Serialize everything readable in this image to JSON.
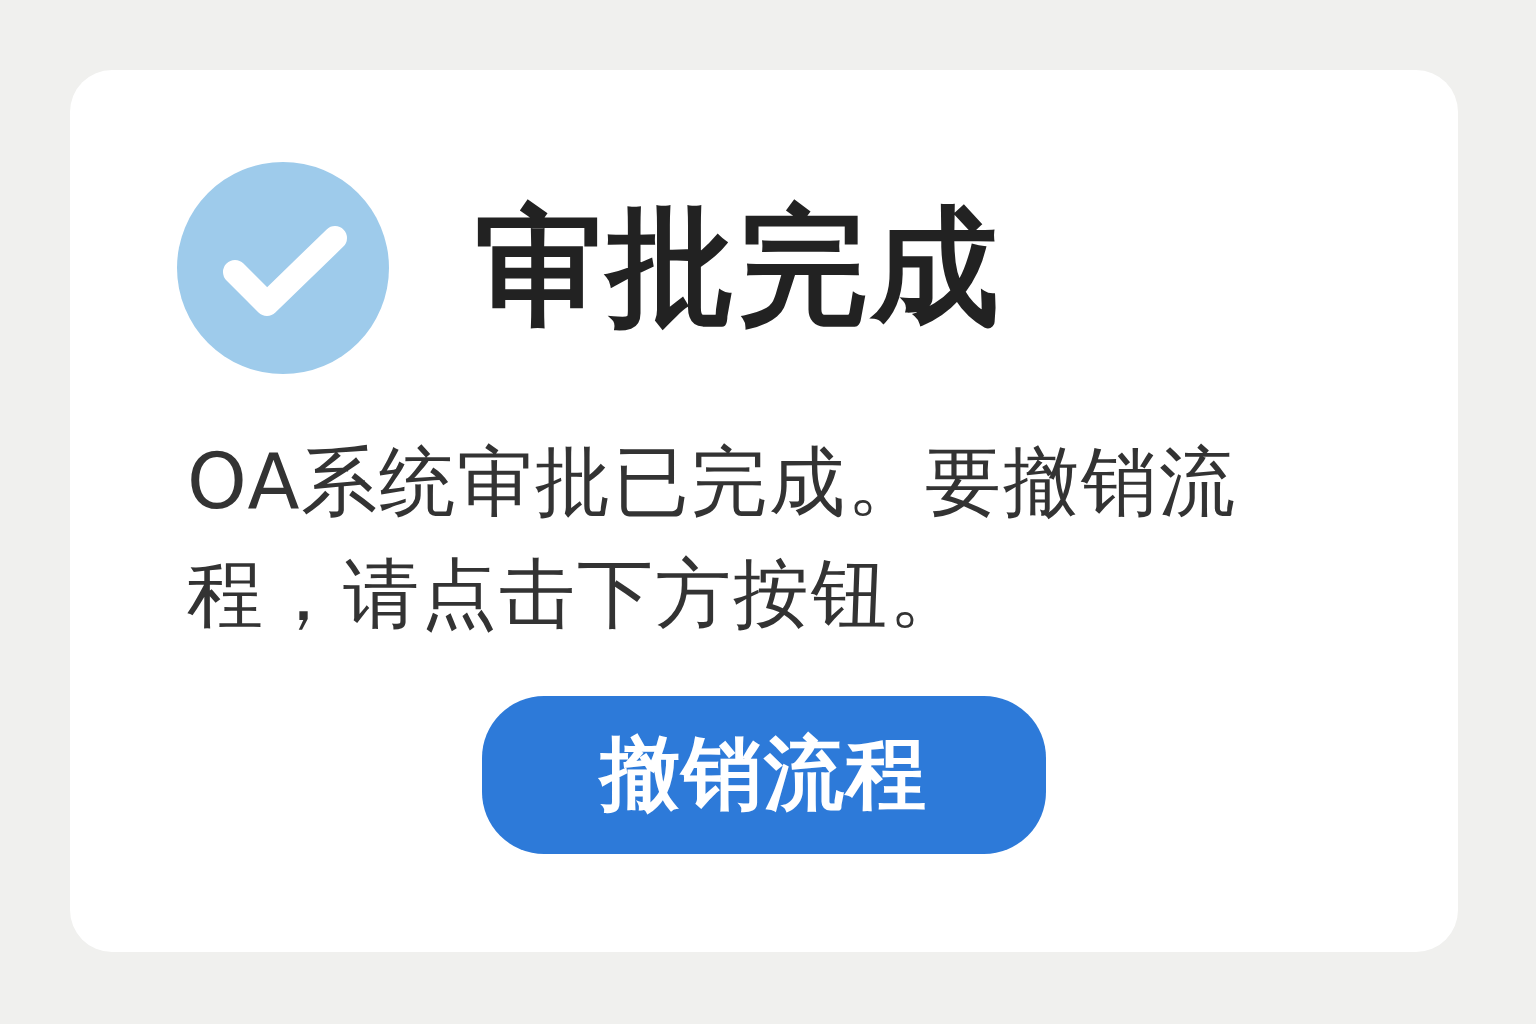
{
  "dialog": {
    "title": "审批完成",
    "success": true,
    "message": "OA系统审批已完成。要撤销流程，请点击下方按钮。",
    "button": "撤销流程"
  }
}
